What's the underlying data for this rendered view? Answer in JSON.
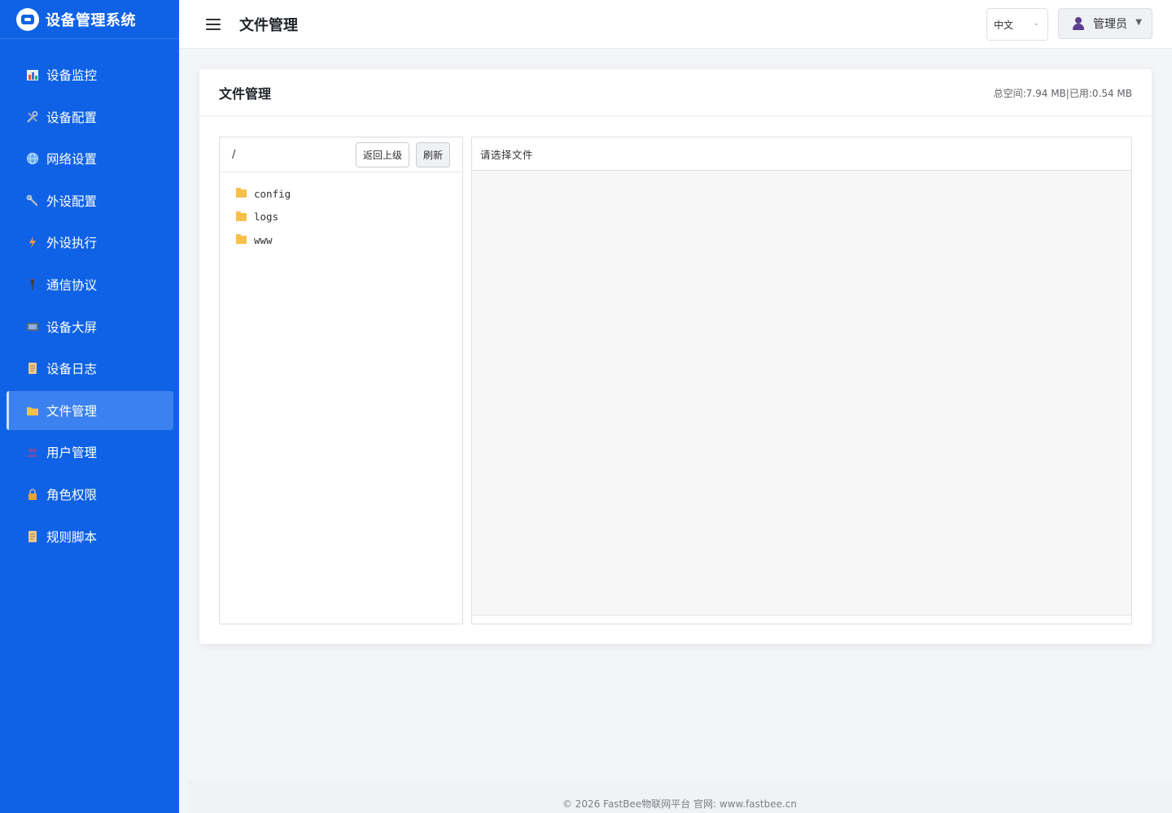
{
  "app": {
    "title": "设备管理系统"
  },
  "sidebar": {
    "items": [
      {
        "label": "设备监控",
        "icon": "bar-chart-icon",
        "active": false
      },
      {
        "label": "设备配置",
        "icon": "tools-icon",
        "active": false
      },
      {
        "label": "网络设置",
        "icon": "globe-icon",
        "active": false
      },
      {
        "label": "外设配置",
        "icon": "wrench-icon",
        "active": false
      },
      {
        "label": "外设执行",
        "icon": "lightning-icon",
        "active": false
      },
      {
        "label": "通信协议",
        "icon": "plug-icon",
        "active": false
      },
      {
        "label": "设备大屏",
        "icon": "monitor-icon",
        "active": false
      },
      {
        "label": "设备日志",
        "icon": "scroll-icon",
        "active": false
      },
      {
        "label": "文件管理",
        "icon": "folder-icon",
        "active": true
      },
      {
        "label": "用户管理",
        "icon": "users-icon",
        "active": false
      },
      {
        "label": "角色权限",
        "icon": "lock-icon",
        "active": false
      },
      {
        "label": "规则脚本",
        "icon": "scroll-icon",
        "active": false
      }
    ]
  },
  "header": {
    "title": "文件管理",
    "language": "中文",
    "user": "管理员"
  },
  "card": {
    "title": "文件管理",
    "storage": "总空间:7.94 MB|已用:0.54 MB"
  },
  "file_tree": {
    "path": "/",
    "back_label": "返回上级",
    "refresh_label": "刷新",
    "items": [
      {
        "name": "config",
        "type": "folder"
      },
      {
        "name": "logs",
        "type": "folder"
      },
      {
        "name": "www",
        "type": "folder"
      }
    ]
  },
  "editor": {
    "placeholder": "请选择文件"
  },
  "footer": {
    "text": "© 2026 FastBee物联网平台 官网: www.fastbee.cn"
  },
  "colors": {
    "sidebar": "#0f62e6",
    "active_item": "#3b82f0",
    "folder": "#f6c04a"
  }
}
